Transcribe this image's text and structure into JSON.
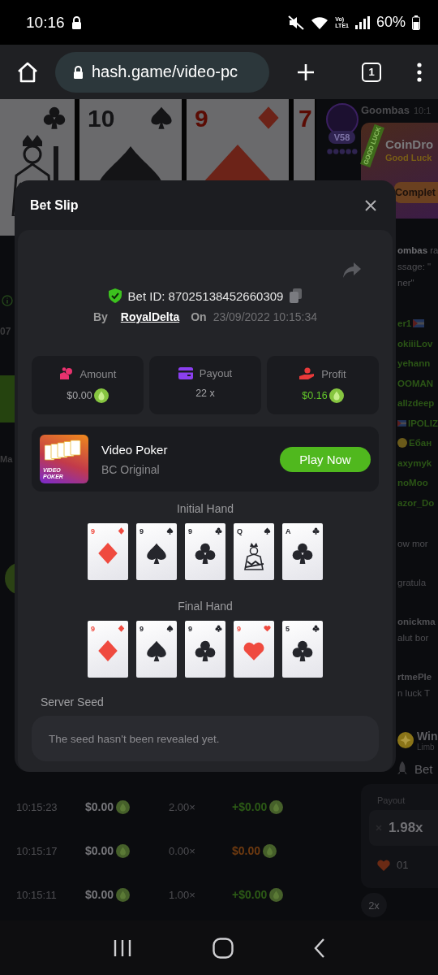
{
  "status_bar": {
    "time": "10:16",
    "volte_top": "Vo)",
    "volte_bottom": "LTE1",
    "battery": "60%"
  },
  "browser": {
    "url": "hash.game/video-pc",
    "tab_count": "1"
  },
  "game_preview": {
    "cards": [
      {
        "kind": "clubs",
        "face": true
      },
      {
        "kind": "spades",
        "rank": "10"
      },
      {
        "kind": "diamonds",
        "rank": "9"
      },
      {
        "kind": "edge",
        "rank": "7",
        "red": true
      }
    ]
  },
  "side_strip": {
    "balance_fragment": "07",
    "tab_fragment": "Ma"
  },
  "chat": {
    "header": {
      "name": "Goombas",
      "time": "10:1",
      "vip": "V58"
    },
    "promo": {
      "ribbon": "GOOD LUCK",
      "title": "CoinDro",
      "subtitle": "Good Luck",
      "button": "Complet"
    },
    "groups": [
      {
        "lines": [
          {
            "kind": "message",
            "text": "**ombas** ra"
          },
          {
            "kind": "message",
            "text": "ssage: \""
          },
          {
            "kind": "message",
            "text": "ner\""
          }
        ]
      },
      {
        "lines": [
          {
            "kind": "user",
            "text": "er1",
            "trailing_flag": true
          },
          {
            "kind": "user",
            "text": "okiiiLov"
          },
          {
            "kind": "user",
            "text": "yehann"
          },
          {
            "kind": "user",
            "text": "OOMAN"
          },
          {
            "kind": "user",
            "text": "allzdeep"
          },
          {
            "kind": "user",
            "text": "IPOLIZ",
            "leading_flag": true
          },
          {
            "kind": "user",
            "text": "Ебан",
            "leading_emoji": true
          },
          {
            "kind": "user",
            "text": "axymyk"
          },
          {
            "kind": "user",
            "text": "noMoo"
          },
          {
            "kind": "user",
            "text": "azor_Do"
          }
        ]
      },
      {
        "lines": [
          {
            "kind": "message",
            "text": "ow mor"
          }
        ]
      },
      {
        "lines": [
          {
            "kind": "faded",
            "text": "gratula"
          }
        ]
      },
      {
        "lines": [
          {
            "kind": "name",
            "text": "onickma"
          },
          {
            "kind": "message",
            "text": "alut bor"
          }
        ]
      },
      {
        "lines": [
          {
            "kind": "name",
            "text": "rtmePle"
          },
          {
            "kind": "message",
            "text": "n luck T"
          }
        ]
      }
    ],
    "win": {
      "title": "Win",
      "subtitle": "Limb"
    },
    "bet_tab": "Bet",
    "payout_label": "Payout",
    "payout_value": "1.98x",
    "likes": "01",
    "chip": "2x"
  },
  "history": [
    {
      "kind": "win",
      "time": "10:15:23",
      "amount": "$0.00",
      "multiplier": "2.00×",
      "profit": "+$0.00"
    },
    {
      "kind": "loss",
      "time": "10:15:17",
      "amount": "$0.00",
      "multiplier": "0.00×",
      "profit": "$0.00"
    },
    {
      "kind": "win",
      "time": "10:15:11",
      "amount": "$0.00",
      "multiplier": "1.00×",
      "profit": "+$0.00"
    }
  ],
  "bet_slip": {
    "title": "Bet Slip",
    "bet_id": "Bet ID: 87025138452660309",
    "by_label": "By",
    "user": "RoyalDelta",
    "on_label": "On",
    "date": "23/09/2022 10:15:34",
    "stats": [
      {
        "kind": "amount",
        "label": "Amount",
        "value": "$0.00",
        "coin": true
      },
      {
        "kind": "payout",
        "label": "Payout",
        "value": "22 x"
      },
      {
        "kind": "profit",
        "label": "Profit",
        "value": "$0.16",
        "coin": true
      }
    ],
    "game": {
      "thumb_top": "VIDEO",
      "thumb_bottom": "POKER",
      "name": "Video Poker",
      "provider": "BC Original",
      "button": "Play Now"
    },
    "hands": [
      {
        "title": "Initial Hand",
        "cards": [
          {
            "kind": "diamonds",
            "rank": "9"
          },
          {
            "kind": "spades",
            "rank": "9"
          },
          {
            "kind": "clubs",
            "rank": "9"
          },
          {
            "kind": "spades",
            "rank": "Q",
            "face": true
          },
          {
            "kind": "clubs",
            "rank": "A"
          }
        ]
      },
      {
        "title": "Final Hand",
        "cards": [
          {
            "kind": "diamonds",
            "rank": "9"
          },
          {
            "kind": "spades",
            "rank": "9"
          },
          {
            "kind": "clubs",
            "rank": "9"
          },
          {
            "kind": "hearts",
            "rank": "9"
          },
          {
            "kind": "clubs",
            "rank": "5"
          }
        ]
      }
    ],
    "seed": {
      "label": "Server Seed",
      "value": "The seed hasn't been revealed yet."
    }
  }
}
